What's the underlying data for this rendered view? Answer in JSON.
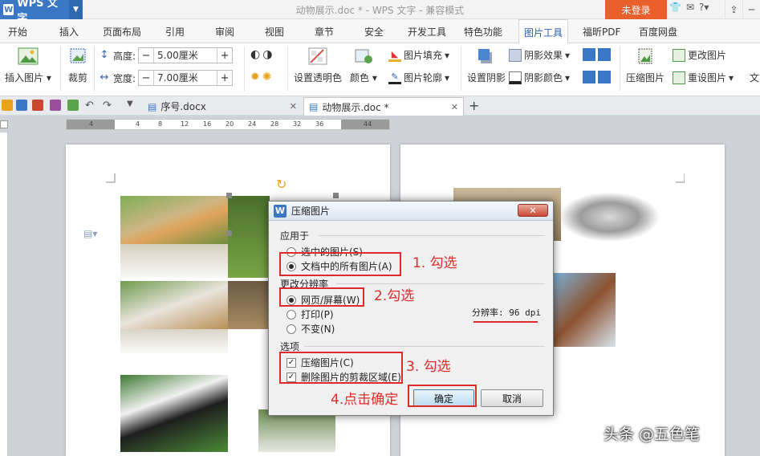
{
  "app": {
    "name": "WPS 文字",
    "logo_letter": "W",
    "window_title": "动物展示.doc * - WPS 文字 - 兼容模式",
    "login_label": "未登录"
  },
  "tabs": [
    "开始",
    "插入",
    "页面布局",
    "引用",
    "审阅",
    "视图",
    "章节",
    "安全",
    "开发工具",
    "特色功能",
    "图片工具",
    "福昕PDF",
    "百度网盘"
  ],
  "active_tab": "图片工具",
  "ribbon": {
    "insert_picture": "插入图片",
    "crop": "裁剪",
    "height_label": "高度:",
    "height_value": "5.00厘米",
    "width_label": "宽度:",
    "width_value": "7.00厘米",
    "set_transparent": "设置透明色",
    "color": "颜色",
    "picture_fill": "图片填充",
    "picture_outline": "图片轮廓",
    "set_shadow": "设置阴影",
    "shadow_effect": "阴影效果",
    "shadow_color": "阴影颜色",
    "compress": "压缩图片",
    "change_picture": "更改图片",
    "reset_picture": "重设图片",
    "more": "文"
  },
  "doc_tabs": [
    {
      "label": "序号.docx"
    },
    {
      "label": "动物展示.doc *"
    }
  ],
  "ruler": {
    "ticks": [
      "4",
      "4",
      "8",
      "12",
      "16",
      "20",
      "24",
      "28",
      "32",
      "36",
      "44"
    ]
  },
  "dialog": {
    "logo_letter": "W",
    "title": "压缩图片",
    "apply_to_label": "应用于",
    "apply_options": [
      "选中的图片(S)",
      "文档中的所有图片(A)"
    ],
    "apply_selected": 1,
    "resolution_label": "更改分辨率",
    "resolution_options": [
      "网页/屏幕(W)",
      "打印(P)",
      "不变(N)"
    ],
    "resolution_selected": 0,
    "dpi_text": "分辨率: 96 dpi",
    "options_label": "选项",
    "checkboxes": [
      {
        "label": "压缩图片(C)",
        "checked": true
      },
      {
        "label": "删除图片的剪裁区域(E)",
        "checked": true
      }
    ],
    "ok_label": "确定",
    "cancel_label": "取消"
  },
  "annotations": {
    "step1": "1. 勾选",
    "step2": "2.勾选",
    "step3": "3. 勾选",
    "step4": "4.点击确定"
  },
  "watermark": "头条 @五色笔",
  "colors": {
    "accent": "#3a78c6",
    "login": "#e9602c",
    "annotation_red": "#e02b2b"
  }
}
